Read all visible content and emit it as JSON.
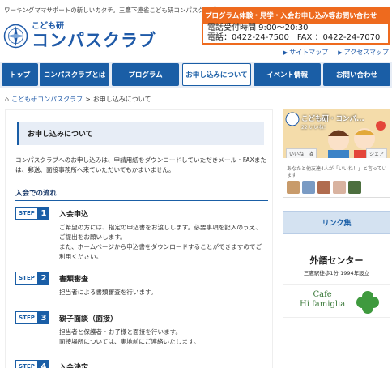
{
  "header": {
    "tagline": "ワーキングママサポートの新しいカタチ。三鷹下連雀こども研コンパスクラブ",
    "logo_small": "こども研",
    "logo_big": "コンパスクラブ",
    "banner": "プログラム体験・見学・入会お申し込み等お問い合わせ",
    "phone_hours": "電話受付時間 9:00～20:30",
    "phone_fax": "電話：0422-24-7500　FAX ：0422-24-7070",
    "sitemap": "サイトマップ",
    "access_map": "アクセスマップ"
  },
  "nav": {
    "items": [
      {
        "label": "トップ"
      },
      {
        "label": "コンパスクラブとは"
      },
      {
        "label": "プログラム"
      },
      {
        "label": "お申し込みについて"
      },
      {
        "label": "イベント情報"
      },
      {
        "label": "お問い合わせ"
      }
    ],
    "active_index": 3
  },
  "breadcrumb": {
    "home": "こども研コンパスクラブ",
    "separator": ">",
    "current": "お申し込みについて"
  },
  "main": {
    "heading": "お申し込みについて",
    "intro": "コンパスクラブへのお申し込みは、申請用紙をダウンロードしていただきメール・FAXまたは、郵送、面接事務所へ来ていただいてもかまいません。",
    "flow_title": "入会での流れ",
    "steps": [
      {
        "label": "STEP",
        "num": "1",
        "title": "入会申込",
        "desc": "ご希望の方には、指定の申込書をお渡しします。必要事項を記入のうえ、ご提出をお願いします。\nまた、ホームページから申込書をダウンロードすることができますのでご利用ください。"
      },
      {
        "label": "STEP",
        "num": "2",
        "title": "書類審査",
        "desc": "担当者による書類審査を行います。"
      },
      {
        "label": "STEP",
        "num": "3",
        "title": "親子面談（面接）",
        "desc": "担当者と保護者・お子様と面接を行います。\n面接場所については、実地前にご連絡いたします。"
      },
      {
        "label": "STEP",
        "num": "4",
        "title": "入会決定",
        "desc": ""
      }
    ]
  },
  "sidebar": {
    "fb_title": "こども研・コンパ...",
    "fb_count": "22 いいね！",
    "fb_like": "いいね！済",
    "fb_share": "シェア",
    "fb_friends": "あなたと他友達4人が「いいね！」と言っています",
    "link_button": "リンク集",
    "gaigo_title": "外語センター",
    "gaigo_sub": "三鷹駅徒歩1分 1994年設立",
    "cafe_line1": "Cafe",
    "cafe_line2": "Hi famiglia"
  },
  "colors": {
    "primary": "#1a5ea6",
    "accent": "#ee6a1e",
    "nav_bg": "#e7edf6"
  }
}
